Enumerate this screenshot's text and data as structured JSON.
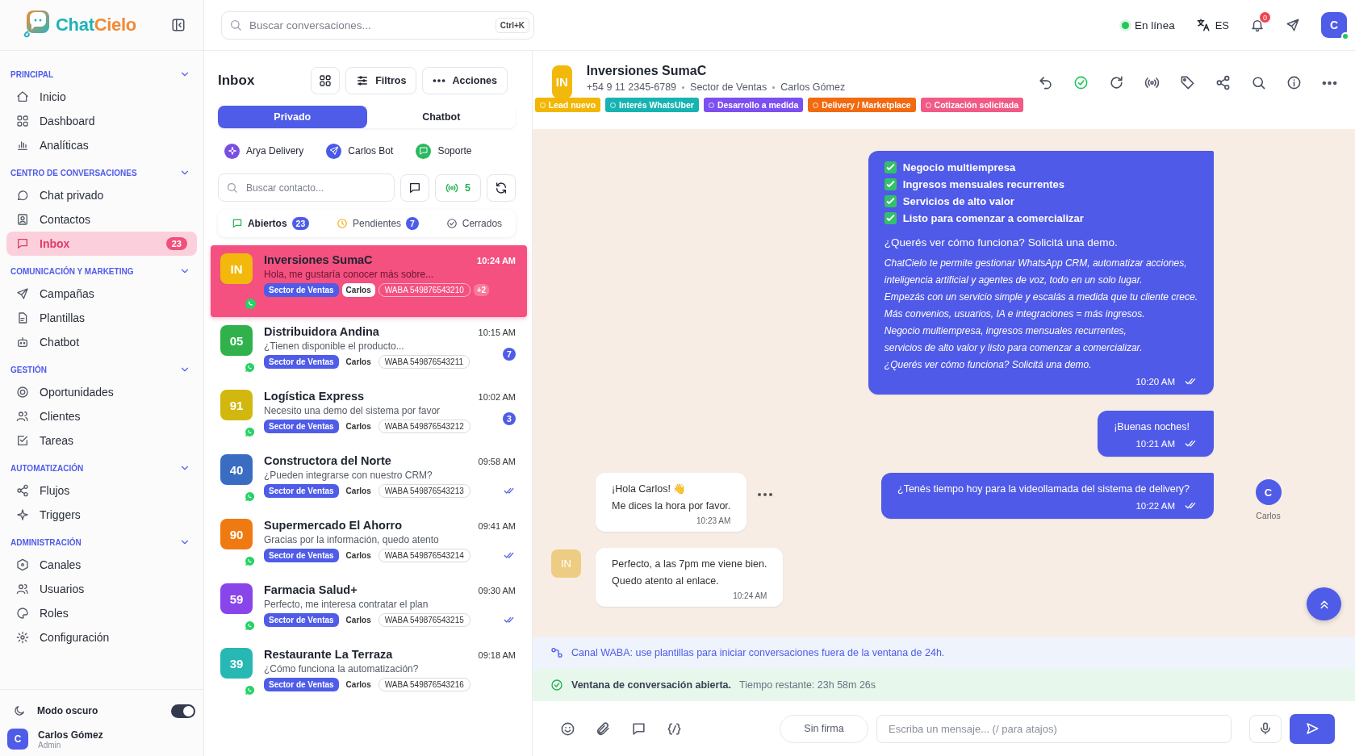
{
  "sidebar": {
    "logo": {
      "part_1": "Chat",
      "part_2": "Cielo"
    },
    "sections": [
      {
        "title": "PRINCIPAL",
        "expanded": true,
        "items": [
          {
            "label": "Inicio",
            "selected": false
          },
          {
            "label": "Dashboard",
            "selected": false
          },
          {
            "label": "Analíticas",
            "selected": false
          }
        ]
      },
      {
        "title": "CENTRO DE CONVERSACIONES",
        "expanded": true,
        "items": [
          {
            "label": "Chat privado",
            "selected": false
          },
          {
            "label": "Contactos",
            "selected": false
          },
          {
            "label": "Inbox",
            "selected": true,
            "badge": "23"
          }
        ]
      },
      {
        "title": "COMUNICACIÓN Y MARKETING",
        "expanded": true,
        "items": [
          {
            "label": "Campañas",
            "selected": false
          },
          {
            "label": "Plantillas",
            "selected": false
          },
          {
            "label": "Chatbot",
            "selected": false
          }
        ]
      },
      {
        "title": "GESTIÓN",
        "expanded": true,
        "items": [
          {
            "label": "Oportunidades",
            "selected": false
          },
          {
            "label": "Clientes",
            "selected": false
          },
          {
            "label": "Tareas",
            "selected": false
          }
        ]
      },
      {
        "title": "AUTOMATIZACIÓN",
        "expanded": true,
        "items": [
          {
            "label": "Flujos",
            "selected": false
          },
          {
            "label": "Triggers",
            "selected": false
          }
        ]
      },
      {
        "title": "ADMINISTRACIÓN",
        "expanded": true,
        "items": [
          {
            "label": "Canales",
            "selected": false
          },
          {
            "label": "Usuarios",
            "selected": false
          },
          {
            "label": "Roles",
            "selected": false
          },
          {
            "label": "Configuración",
            "selected": false
          }
        ]
      }
    ],
    "dark_mode": {
      "label": "Modo oscuro",
      "on": true
    },
    "user": {
      "avatar": "C",
      "name": "Carlos Gómez",
      "role": "Admin"
    }
  },
  "top_bar": {
    "search": {
      "placeholder": "Buscar conversaciones...",
      "shortcut": "Ctrl+K"
    },
    "status": {
      "label": "En línea",
      "online": true
    },
    "language": "ES",
    "notifications": "0",
    "avatar": "C"
  },
  "inbox": {
    "title": "Inbox",
    "buttons": [
      "Filtros",
      "Acciones"
    ],
    "tabs": [
      {
        "label": "Privado",
        "selected": true
      },
      {
        "label": "Chatbot",
        "selected": false
      }
    ],
    "agents": [
      {
        "name": "Arya Delivery",
        "color": "#7b4fe0"
      },
      {
        "name": "Carlos Bot",
        "color": "#4a5ae8"
      },
      {
        "name": "Soporte",
        "color": "#2bb860"
      }
    ],
    "contact_search": {
      "placeholder": "Buscar contacto..."
    },
    "online_count": "5",
    "status_tabs": [
      {
        "label": "Abiertos",
        "count": "23",
        "selected": true
      },
      {
        "label": "Pendientes",
        "count": "7",
        "selected": false
      },
      {
        "label": "Cerrados",
        "selected": false
      }
    ],
    "conversations": [
      {
        "avatar": "IN",
        "color": "#f2b90c",
        "name": "Inversiones SumaC",
        "time": "10:24 AM",
        "preview": "Hola, me gustaría conocer más sobre...",
        "sector": "Sector de Ventas",
        "agent": "Carlos",
        "waba": "WABA 549876543210",
        "extra": "+2",
        "selected": true,
        "read": false
      },
      {
        "avatar": "05",
        "color": "#2fb24c",
        "name": "Distribuidora Andina",
        "time": "10:15 AM",
        "preview": "¿Tienen disponible el producto...",
        "sector": "Sector de Ventas",
        "agent": "Carlos",
        "waba": "WABA 549876543211",
        "unread": "7",
        "selected": false,
        "read": false
      },
      {
        "avatar": "91",
        "color": "#d2b80e",
        "name": "Logística Express",
        "time": "10:02 AM",
        "preview": "Necesito una demo del sistema por favor",
        "sector": "Sector de Ventas",
        "agent": "Carlos",
        "waba": "WABA 549876543212",
        "unread": "3",
        "selected": false,
        "read": false
      },
      {
        "avatar": "40",
        "color": "#3a6cc2",
        "name": "Constructora del Norte",
        "time": "09:58 AM",
        "preview": "¿Pueden integrarse con nuestro CRM?",
        "sector": "Sector de Ventas",
        "agent": "Carlos",
        "waba": "WABA 549876543213",
        "selected": false,
        "read": true
      },
      {
        "avatar": "90",
        "color": "#f07a12",
        "name": "Supermercado El Ahorro",
        "time": "09:41 AM",
        "preview": "Gracias por la información, quedo atento",
        "sector": "Sector de Ventas",
        "agent": "Carlos",
        "waba": "WABA 549876543214",
        "selected": false,
        "read": true
      },
      {
        "avatar": "59",
        "color": "#8a45ea",
        "name": "Farmacia Salud+",
        "time": "09:30 AM",
        "preview": "Perfecto, me interesa contratar el plan",
        "sector": "Sector de Ventas",
        "agent": "Carlos",
        "waba": "WABA 549876543215",
        "selected": false,
        "read": true
      },
      {
        "avatar": "39",
        "color": "#27b8b4",
        "name": "Restaurante La Terraza",
        "time": "09:18 AM",
        "preview": "¿Cómo funciona la automatización?",
        "sector": "Sector de Ventas",
        "agent": "Carlos",
        "waba": "WABA 549876543216",
        "selected": false,
        "read": false
      }
    ]
  },
  "chat": {
    "header": {
      "avatar": "IN",
      "name": "Inversiones SumaC",
      "phone": "+54 9 11 2345-6789",
      "sector": "Sector de Ventas",
      "agent": "Carlos Gómez",
      "tags": [
        {
          "label": "Lead nuevo",
          "color": "#f2b705"
        },
        {
          "label": "Interés WhatsUber",
          "color": "#17b3b3"
        },
        {
          "label": "Desarrollo a medida",
          "color": "#7c4ff0"
        },
        {
          "label": "Delivery / Marketplace",
          "color": "#f26a10"
        },
        {
          "label": "Cotización solicitada",
          "color": "#f25a86"
        }
      ]
    },
    "messages": [
      {
        "kind": "outgoing",
        "blocks": [
          {
            "kind": "check",
            "text": "Negocio multiempresa",
            "checked": true
          },
          {
            "kind": "check",
            "text": "Ingresos mensuales recurrentes",
            "checked": true
          },
          {
            "kind": "check",
            "text": "Servicios de alto valor",
            "checked": true
          },
          {
            "kind": "check",
            "text": "Listo para comenzar a comercializar",
            "checked": true
          },
          {
            "kind": "lead",
            "text": "¿Querés ver cómo funciona? Solicitá una demo."
          },
          {
            "kind": "italic",
            "text": "ChatCielo te permite gestionar WhatsApp CRM, automatizar acciones,"
          },
          {
            "kind": "italic",
            "text": "inteligencia artificial y agentes de voz, todo en un solo lugar."
          },
          {
            "kind": "italic",
            "text": "Empezás con un servicio simple y escalás a medida que tu cliente crece."
          },
          {
            "kind": "italic",
            "text": "Más convenios, usuarios, IA e integraciones = más ingresos."
          },
          {
            "kind": "italic",
            "text": "Negocio multiempresa, ingresos mensuales recurrentes,"
          },
          {
            "kind": "italic",
            "text": "servicios de alto valor y listo para comenzar a comercializar."
          },
          {
            "kind": "italic",
            "text": "¿Querés ver cómo funciona? Solicitá una demo."
          }
        ],
        "time": "10:20 AM",
        "read": true
      },
      {
        "kind": "outgoing",
        "blocks": [
          {
            "kind": "text",
            "text": "¡Buenas noches!"
          }
        ],
        "time": "10:21 AM",
        "read": true
      },
      {
        "kind": "incoming",
        "blocks": [
          {
            "kind": "text",
            "text": "¡Hola Carlos! 👋"
          },
          {
            "kind": "text",
            "text": "Me dices la hora por favor."
          }
        ],
        "time": "10:23 AM",
        "typing": true
      },
      {
        "kind": "outgoing",
        "blocks": [
          {
            "kind": "text",
            "text": "¿Tenés tiempo hoy para la videollamada del sistema de delivery?"
          }
        ],
        "time": "10:22 AM",
        "read": true,
        "sender": {
          "avatar": "C",
          "name": "Carlos"
        }
      },
      {
        "kind": "incoming",
        "avatar": "IN",
        "blocks": [
          {
            "kind": "text",
            "text": "Perfecto, a las 7pm me viene bien."
          },
          {
            "kind": "text",
            "text": "Quedo atento al enlace."
          }
        ],
        "time": "10:24 AM"
      }
    ],
    "notices": [
      {
        "kind": "info",
        "text": "Canal WABA: use plantillas para iniciar conversaciones fuera de la ventana de 24h."
      },
      {
        "kind": "success",
        "title": "Ventana de conversación abierta.",
        "text": "Tiempo restante: 23h 58m 26s"
      }
    ],
    "composer": {
      "signature": "Sin firma",
      "placeholder": "Escriba un mensaje... (/ para atajos)"
    }
  }
}
